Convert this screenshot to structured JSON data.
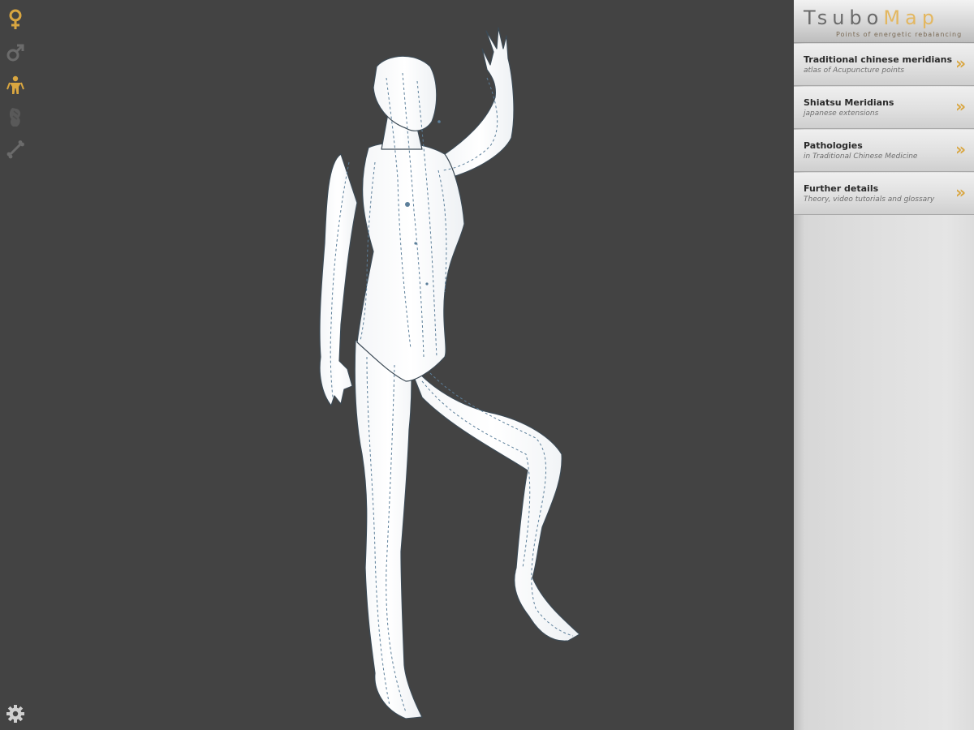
{
  "app": {
    "logo_main": "Tsubo",
    "logo_accent": "Map",
    "logo_tagline": "Points of energetic rebalancing"
  },
  "toolbar": {
    "tools": [
      {
        "name": "female-icon",
        "selected": true
      },
      {
        "name": "male-icon",
        "selected": false
      },
      {
        "name": "body-icon",
        "selected": true
      },
      {
        "name": "muscle-icon",
        "selected": false
      },
      {
        "name": "bone-icon",
        "selected": false
      }
    ],
    "settings_icon": "gear-icon"
  },
  "menu": {
    "items": [
      {
        "title": "Traditional chinese meridians",
        "subtitle": "atlas of Acupuncture points"
      },
      {
        "title": "Shiatsu Meridians",
        "subtitle": "japanese extensions"
      },
      {
        "title": "Pathologies",
        "subtitle": "in Traditional Chinese Medicine"
      },
      {
        "title": "Further details",
        "subtitle": "Theory, video tutorials and glossary"
      }
    ],
    "chevron": "»"
  },
  "colors": {
    "viewport_bg": "#434343",
    "accent": "#d9a640",
    "icon_inactive": "#6b6b6b",
    "meridian_lines": "#5c7f9a"
  }
}
